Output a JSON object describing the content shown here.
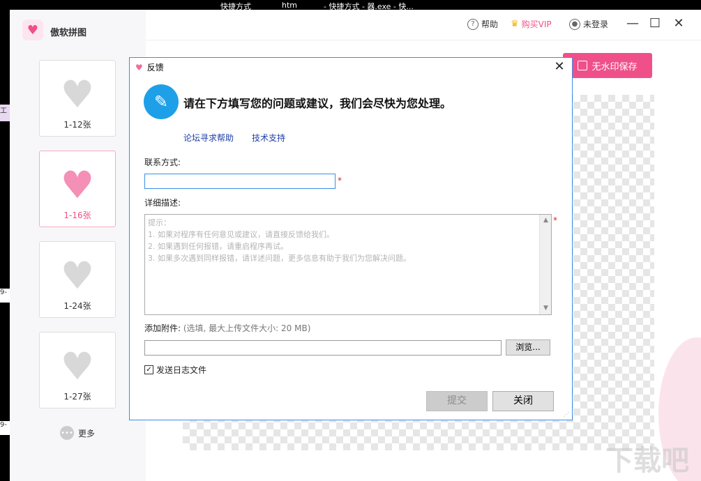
{
  "taskbar": {
    "text1": "快捷方式",
    "text2": "htm",
    "text3": "- 快捷方式 - 器.exe - 快..."
  },
  "app": {
    "title": "傲软拼图",
    "header": {
      "help_label": "帮助",
      "vip_label": "购买VIP",
      "login_label": "未登录"
    },
    "save_label": "无水印保存",
    "templates": [
      {
        "label": "1-12张"
      },
      {
        "label": "1-16张"
      },
      {
        "label": "1-24张"
      },
      {
        "label": "1-27张"
      }
    ],
    "more_label": "更多",
    "edge_labels": [
      "工",
      "9-",
      "9-"
    ]
  },
  "dialog": {
    "title": "反馈",
    "heading": "请在下方填写您的问题或建议，我们会尽快为您处理。",
    "links": {
      "forum": "论坛寻求帮助",
      "support": "技术支持"
    },
    "contact_label": "联系方式:",
    "contact_value": "",
    "required_mark": "*",
    "desc_label": "详细描述:",
    "desc_placeholder": "提示：\n1. 如果对程序有任何意见或建议，请直接反馈给我们。\n2. 如果遇到任何报错，请重启程序再试。\n3. 如果多次遇到同样报错，请详述问题，更多信息有助于我们为您解决问题。",
    "attach_label": "添加附件:",
    "attach_hint": "(选填, 最大上传文件大小: 20 MB)",
    "browse_label": "浏览...",
    "send_log_label": "发送日志文件",
    "send_log_checked": true,
    "submit_label": "提交",
    "close_label": "关闭"
  },
  "watermark": "下载吧"
}
